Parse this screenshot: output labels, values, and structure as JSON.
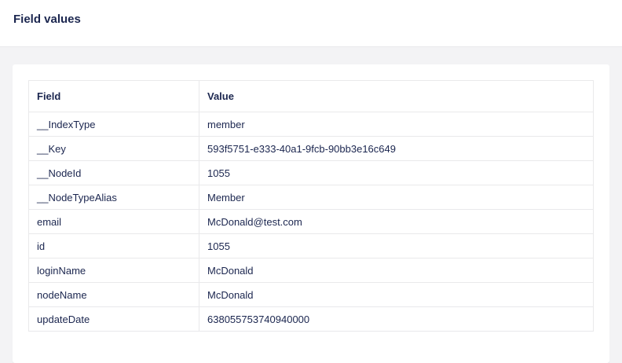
{
  "header": {
    "title": "Field values"
  },
  "table": {
    "columns": [
      "Field",
      "Value"
    ],
    "rows": [
      {
        "field": "__IndexType",
        "value": "member"
      },
      {
        "field": "__Key",
        "value": "593f5751-e333-40a1-9fcb-90bb3e16c649"
      },
      {
        "field": "__NodeId",
        "value": "1055"
      },
      {
        "field": "__NodeTypeAlias",
        "value": "Member"
      },
      {
        "field": "email",
        "value": "McDonald@test.com"
      },
      {
        "field": "id",
        "value": "1055"
      },
      {
        "field": "loginName",
        "value": "McDonald"
      },
      {
        "field": "nodeName",
        "value": "McDonald"
      },
      {
        "field": "updateDate",
        "value": "638055753740940000"
      }
    ]
  }
}
